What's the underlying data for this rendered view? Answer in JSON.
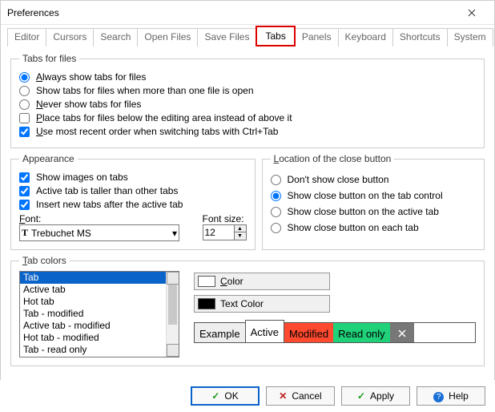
{
  "window": {
    "title": "Preferences"
  },
  "tabs": [
    {
      "label": "Editor"
    },
    {
      "label": "Cursors"
    },
    {
      "label": "Search"
    },
    {
      "label": "Open Files"
    },
    {
      "label": "Save Files"
    },
    {
      "label": "Tabs",
      "active": true
    },
    {
      "label": "Panels"
    },
    {
      "label": "Keyboard"
    },
    {
      "label": "Shortcuts"
    },
    {
      "label": "System"
    }
  ],
  "tabs_for_files": {
    "legend": "Tabs for files",
    "opt_always": "Always show tabs for files",
    "opt_multi": "Show tabs for files when more than one file is open",
    "opt_never": "Never show tabs for files",
    "chk_below": "Place tabs for files below the editing area instead of above it",
    "chk_recent": "Use most recent order when switching tabs with Ctrl+Tab",
    "selected": "always",
    "below": false,
    "recent": true
  },
  "appearance": {
    "legend": "Appearance",
    "chk_images": "Show images on tabs",
    "chk_taller": "Active tab is taller than other tabs",
    "chk_insertafter": "Insert new tabs after the active tab",
    "images": true,
    "taller": true,
    "insertafter": true,
    "font_label": "Font:",
    "font_value": "Trebuchet MS",
    "fontsize_label": "Font size:",
    "fontsize_value": "12"
  },
  "closebtn": {
    "legend": "Location of the close button",
    "opt_none": "Don't show close button",
    "opt_tabctrl": "Show close button on the tab control",
    "opt_active": "Show close button on the active tab",
    "opt_each": "Show close button on each tab",
    "selected": "tabctrl"
  },
  "tabcolors": {
    "legend": "Tab colors",
    "items": [
      "Tab",
      "Active tab",
      "Hot tab",
      "Tab - modified",
      "Active tab - modified",
      "Hot tab - modified",
      "Tab - read only"
    ],
    "selected_index": 0,
    "btn_color": "Color",
    "btn_textcolor": "Text Color",
    "color_swatch": "#ffffff",
    "textcolor_swatch": "#000000",
    "examples": {
      "example": "Example",
      "active": "Active",
      "modified": "Modified",
      "readonly": "Read only"
    }
  },
  "footer": {
    "ok": "OK",
    "cancel": "Cancel",
    "apply": "Apply",
    "help": "Help"
  }
}
